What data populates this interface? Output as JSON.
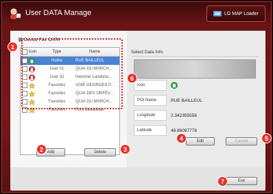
{
  "window": {
    "title": "User DATA Manage",
    "brand_label": "LG MAP Loader"
  },
  "device_panel": {
    "label": "Device Fav. DATA",
    "columns": {
      "icon": "Icon",
      "type": "Type",
      "name": "Name"
    },
    "rows": [
      {
        "type": "Home",
        "name": "RUE BAILLEUL",
        "icon": "home-icon",
        "selected": true
      },
      {
        "type": "User 01",
        "name": "QUAI DU MARCH...",
        "icon": "user-icon",
        "selected": false
      },
      {
        "type": "User 02",
        "name": "Hammer Landstra...",
        "icon": "user-icon",
        "selected": false
      },
      {
        "type": "Favorites",
        "name": "VOIE GEORGES P...",
        "icon": "star-icon",
        "selected": false
      },
      {
        "type": "Favorites",
        "name": "QUAI DES ORFÈV...",
        "icon": "star-icon",
        "selected": false
      },
      {
        "type": "Favorites",
        "name": "QUAI DU MARCH...",
        "icon": "star-icon",
        "selected": false
      },
      {
        "type": "Favorites",
        "name": "Pont Beaudeau",
        "icon": "star-icon",
        "selected": false
      }
    ],
    "add_label": "Add",
    "delete_label": "Delete"
  },
  "select_data": {
    "title": "Select Data Info",
    "fields": {
      "icon_label": "Icon",
      "poi_label": "POI Name",
      "poi_value": "RUE BAILLEUL",
      "lon_label": "Longitude",
      "lon_value": "2.342355556",
      "lat_label": "Latitude",
      "lat_value": "48.86087778"
    },
    "edit_label": "Edit",
    "cancel_label": "Cancel"
  },
  "exit_label": "Exit",
  "badges": [
    "1",
    "2",
    "3",
    "4",
    "5",
    "6",
    "7"
  ],
  "colors": {
    "badge": "#e8312a",
    "selected_row": "#4a82d4",
    "frame": "#7a1818"
  }
}
